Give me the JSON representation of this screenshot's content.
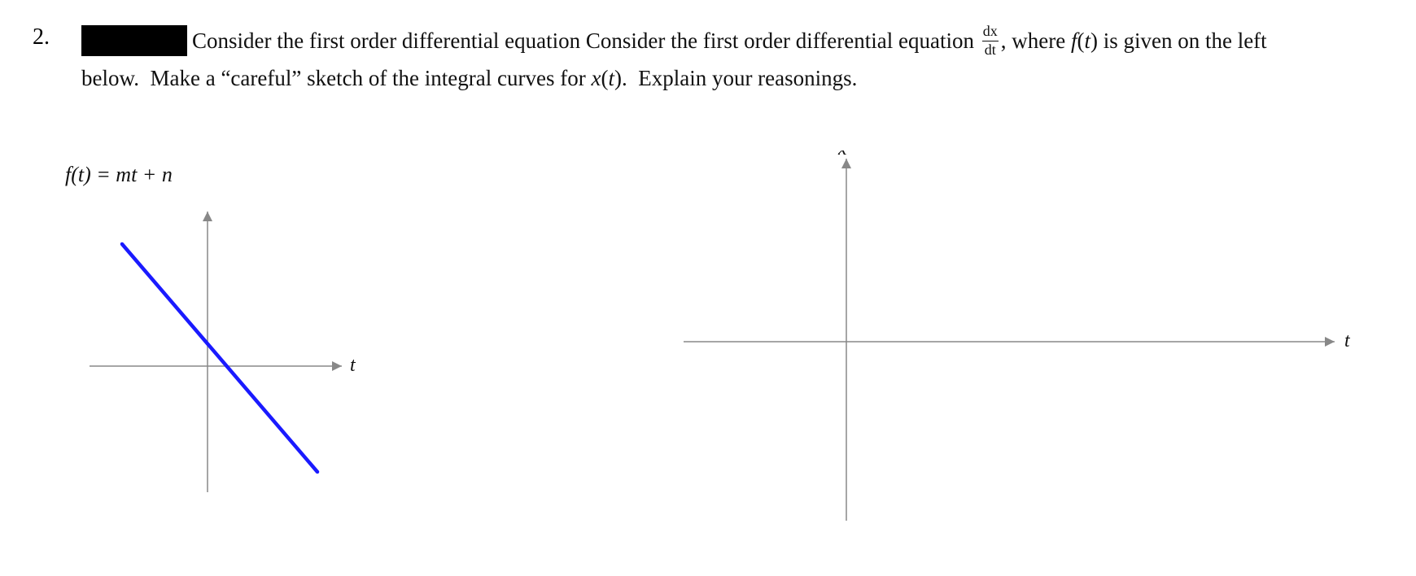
{
  "problem": {
    "number": "2.",
    "text_before": "Consider the first order differential equation",
    "fraction_num": "dx",
    "fraction_den": "dt",
    "text_after_fraction": ", where",
    "f_of_t": "f(t)",
    "text_middle": "is given on the left",
    "text_line2": "below.  Make a “careful” sketch of the integral curves for",
    "x_of_t": "x(t).",
    "text_line2_end": "  Explain your reasonings.",
    "redacted_label": "[redacted]"
  },
  "left_graph": {
    "formula": "f(t) = mt + n",
    "x_axis_label": "t",
    "line_color": "#1a1aff"
  },
  "right_graph": {
    "x_axis_label": "x",
    "t_axis_label": "t"
  }
}
